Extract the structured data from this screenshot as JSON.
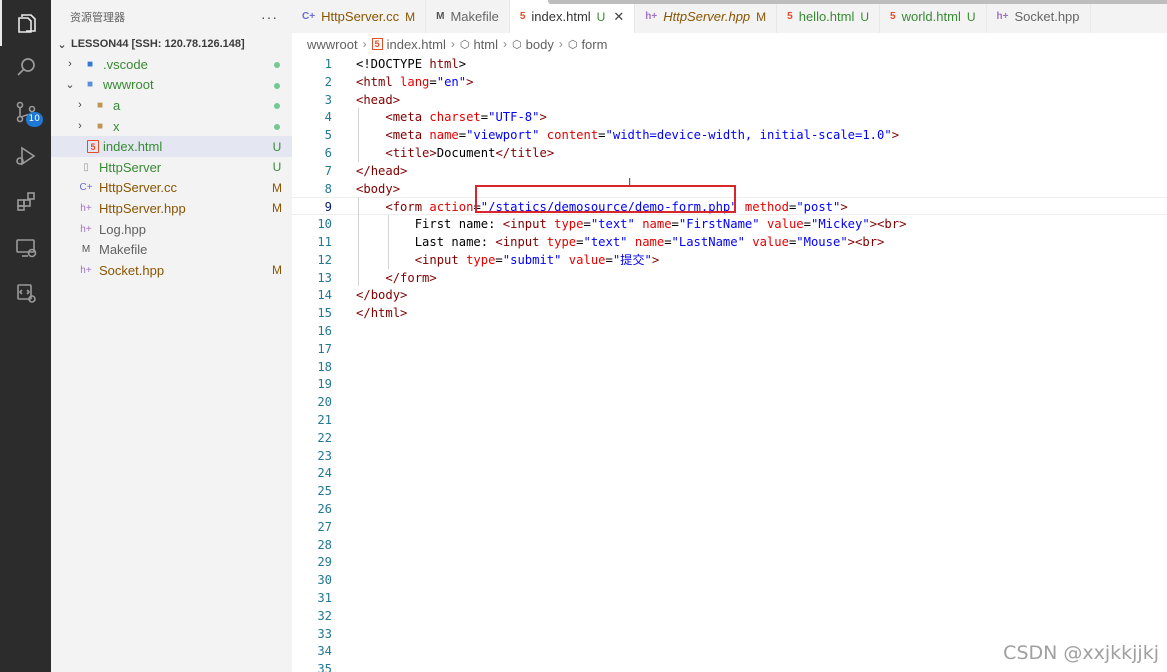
{
  "activity_bar": {
    "items": [
      {
        "icon": "files-icon"
      },
      {
        "icon": "search-icon"
      },
      {
        "icon": "source-control-icon",
        "badge": "10"
      },
      {
        "icon": "run-debug-icon"
      },
      {
        "icon": "extensions-icon"
      },
      {
        "icon": "remote-explorer-icon"
      },
      {
        "icon": "ports-icon"
      }
    ]
  },
  "sidebar": {
    "title": "资源管理器",
    "more_label": "···",
    "workspace": "LESSON44 [SSH: 120.78.126.148]",
    "items": [
      {
        "label": ".vscode",
        "twist": "›",
        "icon": "vscode-folder-icon",
        "status": "dot",
        "color": "#388a34"
      },
      {
        "label": "wwwroot",
        "twist": "⌄",
        "icon": "folder-open-icon",
        "status": "dot",
        "color": "#388a34"
      },
      {
        "label": "a",
        "twist": "›",
        "icon": "folder-icon",
        "status": "dot",
        "color": "#388a34"
      },
      {
        "label": "x",
        "twist": "›",
        "icon": "folder-icon",
        "status": "dot",
        "color": "#388a34"
      },
      {
        "label": "index.html",
        "twist": "",
        "icon": "html-icon",
        "status": "U",
        "color": "#388a34"
      },
      {
        "label": "HttpServer",
        "twist": "",
        "icon": "file-icon",
        "status": "U",
        "color": "#388a34"
      },
      {
        "label": "HttpServer.cc",
        "twist": "",
        "icon": "cpp-icon",
        "status": "M",
        "color": "#895503"
      },
      {
        "label": "HttpServer.hpp",
        "twist": "",
        "icon": "hpp-icon",
        "status": "M",
        "color": "#895503"
      },
      {
        "label": "Log.hpp",
        "twist": "",
        "icon": "hpp-icon",
        "status": "",
        "color": "#616161"
      },
      {
        "label": "Makefile",
        "twist": "",
        "icon": "makefile-icon",
        "status": "",
        "color": "#616161"
      },
      {
        "label": "Socket.hpp",
        "twist": "",
        "icon": "hpp-icon",
        "status": "M",
        "color": "#895503"
      }
    ]
  },
  "tabs": [
    {
      "label": "HttpServer.cc",
      "mark": "M",
      "icon": "cpp-icon",
      "active": false
    },
    {
      "label": "Makefile",
      "mark": "",
      "icon": "makefile-icon",
      "active": false
    },
    {
      "label": "index.html",
      "mark": "U",
      "icon": "html-icon",
      "active": true,
      "close": "✕"
    },
    {
      "label": "HttpServer.hpp",
      "mark": "M",
      "icon": "hpp-icon",
      "active": false
    },
    {
      "label": "hello.html",
      "mark": "U",
      "icon": "html-icon",
      "active": false
    },
    {
      "label": "world.html",
      "mark": "U",
      "icon": "html-icon",
      "active": false
    },
    {
      "label": "Socket.hpp",
      "mark": "",
      "icon": "hpp-icon",
      "active": false
    }
  ],
  "breadcrumb": [
    "wwwroot",
    "index.html",
    "html",
    "body",
    "form"
  ],
  "editor": {
    "current_line": 9,
    "total_lines": 35,
    "lines": [
      [
        [
          "t",
          "<!DOCTYPE "
        ],
        [
          "tag",
          "html"
        ],
        [
          "t",
          ">"
        ]
      ],
      [
        [
          "p",
          "<"
        ],
        [
          "tag",
          "html"
        ],
        [
          "a",
          " lang"
        ],
        [
          "t",
          "="
        ],
        [
          "v",
          "\"en\""
        ],
        [
          "p",
          ">"
        ]
      ],
      [
        [
          "p",
          "<"
        ],
        [
          "tag",
          "head"
        ],
        [
          "p",
          ">"
        ]
      ],
      [
        [
          "s",
          "    "
        ],
        [
          "p",
          "<"
        ],
        [
          "tag",
          "meta"
        ],
        [
          "a",
          " charset"
        ],
        [
          "t",
          "="
        ],
        [
          "v",
          "\"UTF-8\""
        ],
        [
          "p",
          ">"
        ]
      ],
      [
        [
          "s",
          "    "
        ],
        [
          "p",
          "<"
        ],
        [
          "tag",
          "meta"
        ],
        [
          "a",
          " name"
        ],
        [
          "t",
          "="
        ],
        [
          "v",
          "\"viewport\""
        ],
        [
          "a",
          " content"
        ],
        [
          "t",
          "="
        ],
        [
          "v",
          "\"width=device-width, initial-scale=1.0\""
        ],
        [
          "p",
          ">"
        ]
      ],
      [
        [
          "s",
          "    "
        ],
        [
          "p",
          "<"
        ],
        [
          "tag",
          "title"
        ],
        [
          "p",
          ">"
        ],
        [
          "t",
          "Document"
        ],
        [
          "p",
          "</"
        ],
        [
          "tag",
          "title"
        ],
        [
          "p",
          ">"
        ]
      ],
      [
        [
          "p",
          "</"
        ],
        [
          "tag",
          "head"
        ],
        [
          "p",
          ">"
        ]
      ],
      [
        [
          "p",
          "<"
        ],
        [
          "tag",
          "body"
        ],
        [
          "p",
          ">"
        ]
      ],
      [
        [
          "s",
          "    "
        ],
        [
          "p",
          "<"
        ],
        [
          "tag",
          "form"
        ],
        [
          "a",
          " action"
        ],
        [
          "t",
          "="
        ],
        [
          "v",
          "\"/statics/demosource/demo-form.php\""
        ],
        [
          "a",
          " method"
        ],
        [
          "t",
          "="
        ],
        [
          "v",
          "\"post\""
        ],
        [
          "p",
          ">"
        ]
      ],
      [
        [
          "s",
          "        "
        ],
        [
          "t",
          "First name: "
        ],
        [
          "p",
          "<"
        ],
        [
          "tag",
          "input"
        ],
        [
          "a",
          " type"
        ],
        [
          "t",
          "="
        ],
        [
          "v",
          "\"text\""
        ],
        [
          "a",
          " name"
        ],
        [
          "t",
          "="
        ],
        [
          "v",
          "\"FirstName\""
        ],
        [
          "a",
          " value"
        ],
        [
          "t",
          "="
        ],
        [
          "v",
          "\"Mickey\""
        ],
        [
          "p",
          "><"
        ],
        [
          "tag",
          "br"
        ],
        [
          "p",
          ">"
        ]
      ],
      [
        [
          "s",
          "        "
        ],
        [
          "t",
          "Last name: "
        ],
        [
          "p",
          "<"
        ],
        [
          "tag",
          "input"
        ],
        [
          "a",
          " type"
        ],
        [
          "t",
          "="
        ],
        [
          "v",
          "\"text\""
        ],
        [
          "a",
          " name"
        ],
        [
          "t",
          "="
        ],
        [
          "v",
          "\"LastName\""
        ],
        [
          "a",
          " value"
        ],
        [
          "t",
          "="
        ],
        [
          "v",
          "\"Mouse\""
        ],
        [
          "p",
          "><"
        ],
        [
          "tag",
          "br"
        ],
        [
          "p",
          ">"
        ]
      ],
      [
        [
          "s",
          "        "
        ],
        [
          "p",
          "<"
        ],
        [
          "tag",
          "input"
        ],
        [
          "a",
          " type"
        ],
        [
          "t",
          "="
        ],
        [
          "v",
          "\"submit\""
        ],
        [
          "a",
          " value"
        ],
        [
          "t",
          "="
        ],
        [
          "v",
          "\"提交\""
        ],
        [
          "p",
          ">"
        ]
      ],
      [
        [
          "s",
          "    "
        ],
        [
          "p",
          "</"
        ],
        [
          "tag",
          "form"
        ],
        [
          "p",
          ">"
        ]
      ],
      [
        [
          "p",
          "</"
        ],
        [
          "tag",
          "body"
        ],
        [
          "p",
          ">"
        ]
      ],
      [
        [
          "p",
          "</"
        ],
        [
          "tag",
          "html"
        ],
        [
          "p",
          ">"
        ]
      ]
    ]
  },
  "cursor_glyph": "I",
  "watermark": "CSDN @xxjkkjjkj"
}
